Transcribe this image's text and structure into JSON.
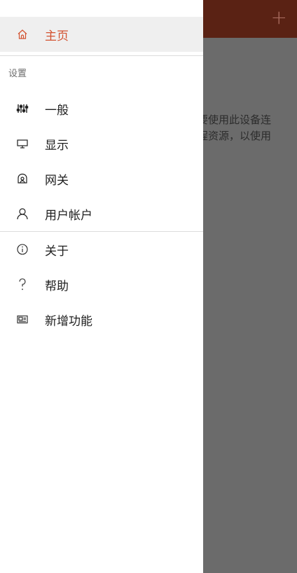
{
  "background": {
    "add_icon": "plus-icon",
    "body_text_line1": "要使用此设备连",
    "body_text_line2": "程资源，以使用"
  },
  "drawer": {
    "home": {
      "label": "主页",
      "icon": "home-icon"
    },
    "settings_section": "设置",
    "items": [
      {
        "label": "一般",
        "icon": "sliders-icon"
      },
      {
        "label": "显示",
        "icon": "monitor-icon"
      },
      {
        "label": "网关",
        "icon": "gateway-icon"
      },
      {
        "label": "用户帐户",
        "icon": "user-icon"
      }
    ],
    "footer_items": [
      {
        "label": "关于",
        "icon": "info-icon"
      },
      {
        "label": "帮助",
        "icon": "help-icon"
      },
      {
        "label": "新增功能",
        "icon": "whats-new-icon"
      }
    ]
  },
  "colors": {
    "accent": "#d35230",
    "header_dimmed": "#5a2214",
    "overlay": "#6b6b6b"
  }
}
